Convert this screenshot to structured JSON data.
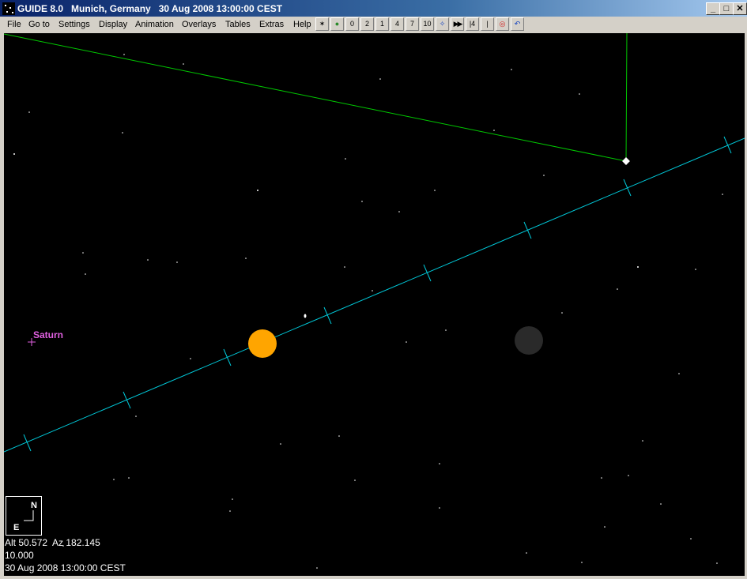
{
  "window": {
    "app_name": "GUIDE 8.0",
    "location": "Munich, Germany",
    "datetime": "30 Aug 2008 13:00:00 CEST",
    "controls": {
      "minimize": "_",
      "maximize": "□",
      "close": "✕"
    }
  },
  "menu": [
    "File",
    "Go to",
    "Settings",
    "Display",
    "Animation",
    "Overlays",
    "Tables",
    "Extras",
    "Help"
  ],
  "toolbar": [
    {
      "name": "star-chart-icon",
      "glyph": "✶"
    },
    {
      "name": "planet-icon",
      "glyph": "●"
    },
    {
      "name": "zoom-level-0-icon",
      "glyph": "0"
    },
    {
      "name": "zoom-level-2-icon",
      "glyph": "2"
    },
    {
      "name": "zoom-level-1-icon",
      "glyph": "1"
    },
    {
      "name": "zoom-level-4-icon",
      "glyph": "4"
    },
    {
      "name": "zoom-level-7-icon",
      "glyph": "7"
    },
    {
      "name": "zoom-level-10-icon",
      "glyph": "10"
    },
    {
      "name": "sparkle-icon",
      "glyph": "✧"
    },
    {
      "name": "fast-forward-icon",
      "glyph": "▶▶"
    },
    {
      "name": "step-14-icon",
      "glyph": "|4"
    },
    {
      "name": "step-single-icon",
      "glyph": "|"
    },
    {
      "name": "target-icon",
      "glyph": "◎"
    },
    {
      "name": "undo-icon",
      "glyph": "↶"
    }
  ],
  "sky": {
    "objects": {
      "saturn_label": "Saturn"
    },
    "colors": {
      "background": "#000000",
      "ecliptic": "#00c8d8",
      "horizon_line": "#00c800",
      "sun": "#ffa500",
      "moon": "#2a2a2a",
      "saturn": "#e060e0"
    }
  },
  "compass": {
    "north": "N",
    "east": "E"
  },
  "status": {
    "alt_az": "Alt 50.572  Az 182.145",
    "field": "10.000",
    "datetime": "30 Aug 2008 13:00:00 CEST"
  }
}
